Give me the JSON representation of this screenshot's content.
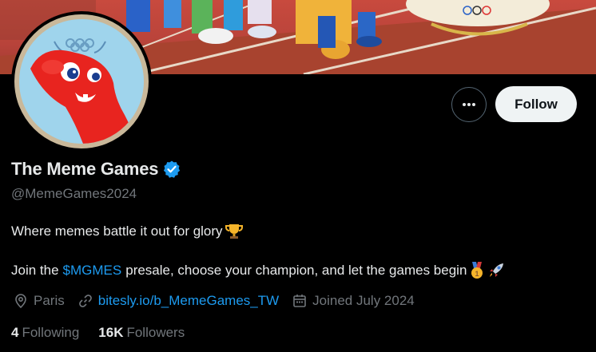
{
  "profile": {
    "name": "The Meme Games",
    "handle": "@MemeGames2024",
    "bio_line1": "Where memes battle it out for glory",
    "bio_line2_prefix": "Join the",
    "bio_cashtag": "$MGMES",
    "bio_line2_suffix": "presale, choose your champion, and let the games begin",
    "location": "Paris",
    "website": "bitesly.io/b_MemeGames_TW",
    "joined": "Joined July 2024",
    "following_count": "4",
    "following_label": "Following",
    "followers_count": "16K",
    "followers_label": "Followers"
  },
  "actions": {
    "follow_label": "Follow"
  },
  "icons": {
    "more": "more-dots-icon",
    "verified": "verified-badge-icon",
    "location": "location-pin-icon",
    "link": "link-icon",
    "calendar": "calendar-icon",
    "trophy": "trophy-emoji",
    "medal": "gold-medal-emoji",
    "rocket": "rocket-emoji"
  },
  "colors": {
    "background": "#000000",
    "accent": "#1d9bf0",
    "secondary_text": "#71767b",
    "follow_bg": "#eff3f4"
  }
}
